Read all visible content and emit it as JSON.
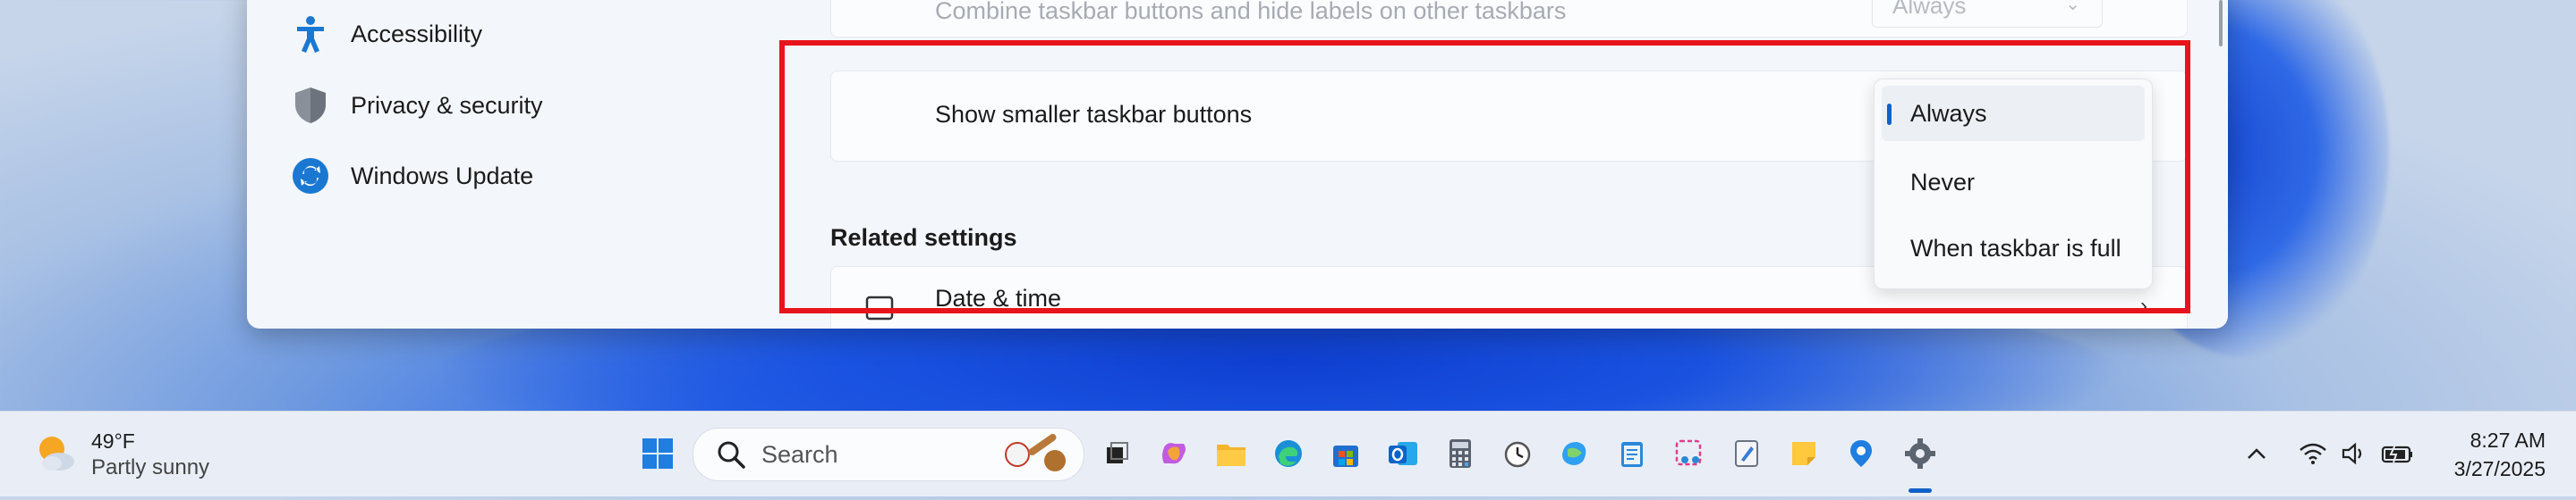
{
  "nav": {
    "items": [
      {
        "label": "Accessibility",
        "icon": "accessibility-icon"
      },
      {
        "label": "Privacy & security",
        "icon": "shield-icon"
      },
      {
        "label": "Windows Update",
        "icon": "windows-update-icon"
      }
    ]
  },
  "content": {
    "combine_other_label": "Combine taskbar buttons and hide labels on other taskbars",
    "combine_other_value": "Always",
    "smaller_buttons_label": "Show smaller taskbar buttons",
    "related_settings_title": "Related settings",
    "date_time_label": "Date & time"
  },
  "dropdown": {
    "options": [
      "Always",
      "Never",
      "When taskbar is full"
    ],
    "selected": "Always"
  },
  "taskbar": {
    "weather_temp": "49°F",
    "weather_desc": "Partly sunny",
    "search_placeholder": "Search",
    "time": "8:27 AM",
    "date": "3/27/2025",
    "apps": [
      "start-icon",
      "task-view-icon",
      "copilot-icon",
      "file-explorer-icon",
      "edge-icon",
      "store-icon",
      "outlook-icon",
      "calculator-icon",
      "clock-icon",
      "photos-icon",
      "notepad-icon",
      "snipping-tool-icon",
      "paint-icon",
      "sticky-notes-icon",
      "maps-icon",
      "settings-icon"
    ]
  },
  "colors": {
    "accent": "#0f62c8",
    "highlight_border": "#e8141c"
  }
}
